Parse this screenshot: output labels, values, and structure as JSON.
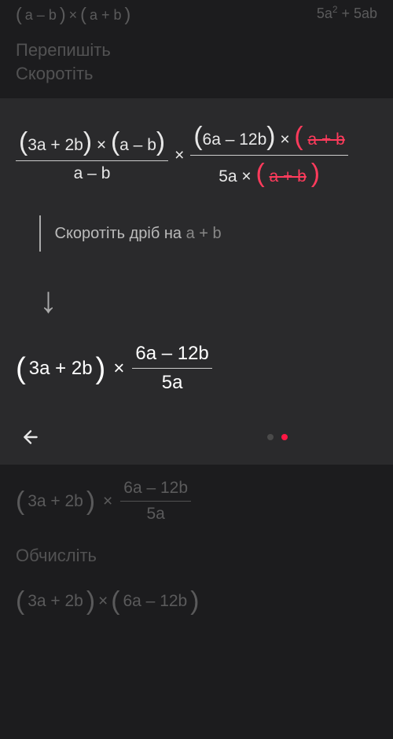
{
  "top": {
    "left_expr": {
      "factor1": "a – b",
      "factor2": "a + b"
    },
    "right_expr": "5a² + 5ab",
    "heading1": "Перепишіть",
    "heading2": "Скоротіть"
  },
  "main": {
    "frac1": {
      "num_f1": "3a + 2b",
      "num_f2": "a – b",
      "den": "a – b"
    },
    "frac2": {
      "num_f1": "6a – 12b",
      "num_strike": "a + b",
      "den_coef": "5a",
      "den_strike": "a + b"
    },
    "step_label": "Скоротіть дріб на",
    "step_term": "a + b",
    "result": {
      "factor": "3a + 2b",
      "frac_num": "6a – 12b",
      "frac_den": "5a"
    }
  },
  "bottom": {
    "expr1": {
      "factor": "3a + 2b",
      "frac_num": "6a – 12b",
      "frac_den": "5a"
    },
    "heading": "Обчисліть",
    "expr2": {
      "f1": "3a + 2b",
      "f2": "6a – 12b"
    }
  }
}
